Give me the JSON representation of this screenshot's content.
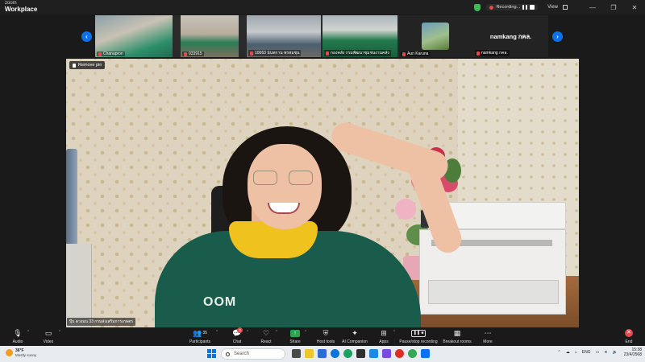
{
  "app": {
    "brand_small": "zoom",
    "brand_big": "Workplace",
    "recording_label": "Recording...",
    "view_label": "View",
    "window_min": "—",
    "window_restore": "❐",
    "window_close": "✕"
  },
  "strip": {
    "prev": "‹",
    "next": "›",
    "participants": [
      {
        "name": "Chanapron"
      },
      {
        "name": "033915"
      },
      {
        "name": "10063 นันทกาน พรหมชุน"
      },
      {
        "name": "กองคลัง กรมพัฒนาชุมชนงานคลัง"
      },
      {
        "name": "Aun Karuna"
      },
      {
        "name": "namkang กคล.",
        "big_label": "namkang กคล."
      }
    ]
  },
  "main_video": {
    "remove_pin_label": "Remove pin",
    "participant_name": "ปุ๊บ ดวงมน 33 กรมส่งเสริมการเกษตร",
    "shirt_text": "OOM"
  },
  "toolbar": {
    "audio": "Audio",
    "video": "Video",
    "participants": "Participants",
    "participants_count": "35",
    "chat": "Chat",
    "chat_badge": "2",
    "react": "React",
    "share": "Share",
    "host_tools": "Host tools",
    "ai_companion": "AI Companion",
    "apps": "Apps",
    "pause_stop_recording": "Pause/stop recording",
    "breakout_rooms": "Breakout rooms",
    "more": "More",
    "end": "End"
  },
  "taskbar": {
    "temp": "36°F",
    "condition": "Mostly sunny",
    "search_placeholder": "Search",
    "lang": "ENG",
    "time": "15:38",
    "date": "23/4/2568"
  },
  "colors": {
    "accent": "#0e71eb",
    "record_red": "#e5484d",
    "share_green": "#2aa44f"
  }
}
